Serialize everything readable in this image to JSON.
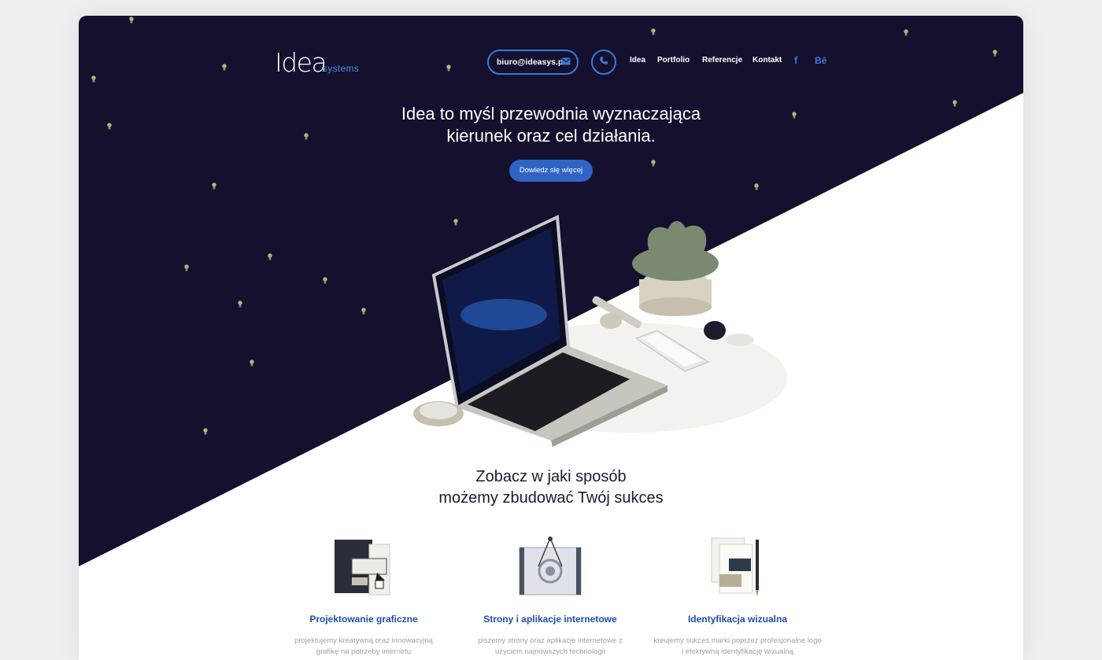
{
  "header": {
    "logo_main": "Idea",
    "logo_sub": "systems",
    "email": "biuro@ideasys.pl",
    "nav": [
      "Idea",
      "Portfolio",
      "Referencje",
      "Kontakt"
    ],
    "social": {
      "facebook": "f",
      "behance": "Bē"
    }
  },
  "hero": {
    "headline_line1": "Idea to myśl przewodnia wyznaczająca",
    "headline_line2": "kierunek oraz cel działania.",
    "cta": "Dowiedz się więcej"
  },
  "section": {
    "headline_line1": "Zobacz w jaki sposób",
    "headline_line2": "możemy zbudować Twój sukces"
  },
  "services": [
    {
      "title": "Projektowanie graficzne",
      "desc_line1": "projektujemy kreatywną oraz innowacyjną",
      "desc_line2": "grafikę na potrzeby internetu"
    },
    {
      "title": "Strony i aplikacje internetowe",
      "desc_line1": "piszemy strony oraz aplikacje internetowe z",
      "desc_line2": "użyciem najnowszych technologii"
    },
    {
      "title": "Identyfikacja wizualna",
      "desc_line1": "kreujemy sukces marki poprzez profesjonalne logo",
      "desc_line2": "i efektywną identyfikację wizualną"
    }
  ],
  "colors": {
    "navy": "#14102e",
    "accent": "#3a78d6",
    "bulb": "#b9b27a"
  },
  "icons": [
    "mail-icon",
    "phone-icon",
    "facebook-icon",
    "behance-icon",
    "lightbulb-icon"
  ]
}
